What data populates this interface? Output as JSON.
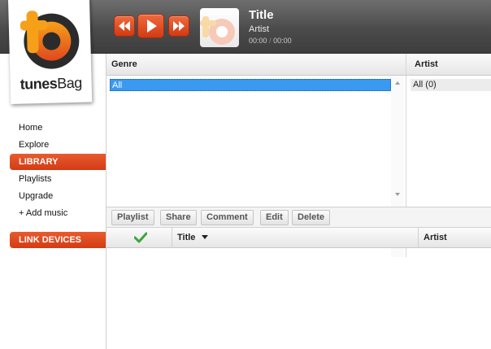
{
  "player": {
    "title": "Title",
    "artist": "Artist",
    "time_current": "00:00",
    "time_separator": "/",
    "time_total": "00:00"
  },
  "brand": {
    "name_bold": "tunes",
    "name_regular": "Bag",
    "logo_letter": "b",
    "accent": "#e0481f"
  },
  "sidebar": {
    "items": [
      {
        "label": "Home"
      },
      {
        "label": "Explore"
      },
      {
        "label": "LIBRARY"
      },
      {
        "label": "Playlists"
      },
      {
        "label": "Upgrade"
      },
      {
        "label": "+ Add music"
      },
      {
        "label": "LINK DEVICES"
      }
    ]
  },
  "browser": {
    "genre_header": "Genre",
    "artist_header": "Artist",
    "genre_selected": "All",
    "artist_first": "All (0)"
  },
  "toolbar": {
    "playlist": "Playlist",
    "share": "Share",
    "comment": "Comment",
    "edit": "Edit",
    "delete": "Delete"
  },
  "tracklist": {
    "columns": {
      "title": "Title",
      "artist": "Artist"
    },
    "check_icon": "checkmark-icon",
    "sort_icon": "sort-down-icon"
  }
}
